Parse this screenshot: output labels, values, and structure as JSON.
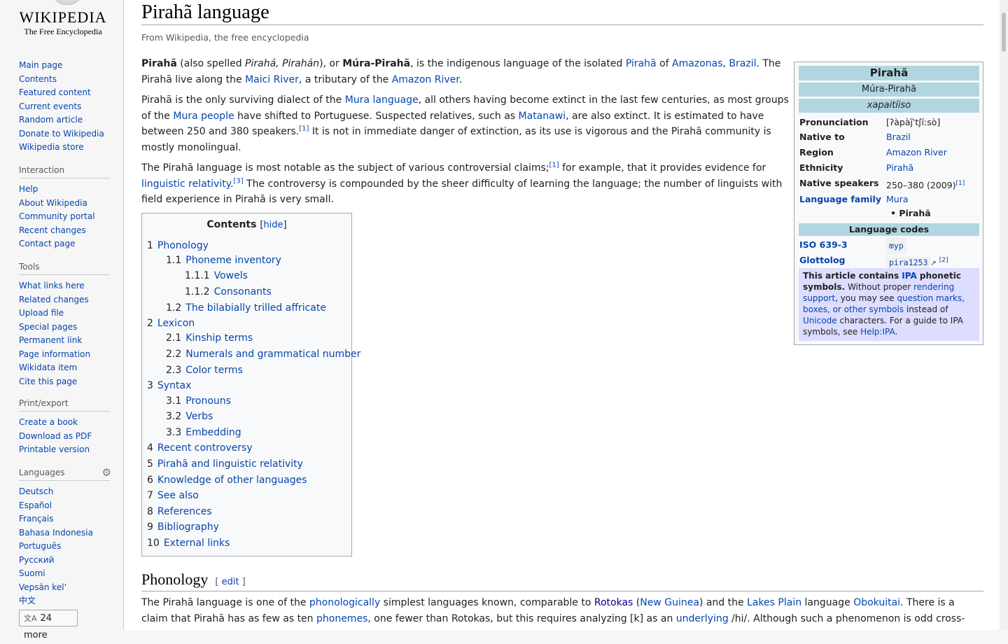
{
  "logo": {
    "wordmark": "WIKIPEDIA",
    "tagline": "The Free Encyclopedia"
  },
  "sidebar": {
    "navigation": [
      "Main page",
      "Contents",
      "Featured content",
      "Current events",
      "Random article",
      "Donate to Wikipedia",
      "Wikipedia store"
    ],
    "interaction": {
      "heading": "Interaction",
      "items": [
        "Help",
        "About Wikipedia",
        "Community portal",
        "Recent changes",
        "Contact page"
      ]
    },
    "tools": {
      "heading": "Tools",
      "items": [
        "What links here",
        "Related changes",
        "Upload file",
        "Special pages",
        "Permanent link",
        "Page information",
        "Wikidata item",
        "Cite this page"
      ]
    },
    "print": {
      "heading": "Print/export",
      "items": [
        "Create a book",
        "Download as PDF",
        "Printable version"
      ]
    },
    "languages": {
      "heading": "Languages",
      "items": [
        "Deutsch",
        "Español",
        "Français",
        "Bahasa Indonesia",
        "Português",
        "Русский",
        "Suomi",
        "Vepsän kel’",
        "中文"
      ],
      "more_icon": "文A",
      "more_label": "24 more",
      "settings_icon": "gear-icon"
    }
  },
  "page": {
    "title": "Pirahã language",
    "tagline": "From Wikipedia, the free encyclopedia"
  },
  "intro": {
    "p1": {
      "t0": "Pirahã",
      "t1": " (also spelled ",
      "t2": "Pirahá, Pirahán",
      "t3": "), or ",
      "t4": "Múra-Pirahã",
      "t5": ", is the indigenous language of the isolated ",
      "l1": "Pirahã",
      "t6": " of ",
      "l2": "Amazonas",
      "t7": ", ",
      "l3": "Brazil",
      "t8": ". The Pirahã live along the ",
      "l4": "Maici River",
      "t9": ", a tributary of the ",
      "l5": "Amazon River",
      "t10": "."
    },
    "p2": {
      "t1": "Pirahã is the only surviving dialect of the ",
      "l1": "Mura language",
      "t2": ", all others having become extinct in the last few centuries, as most groups of the ",
      "l2": "Mura people",
      "t3": " have shifted to Portuguese. Suspected relatives, such as ",
      "l3": "Matanawi",
      "t4": ", are also extinct. It is estimated to have between 250 and 380 speakers.",
      "r1": "[1]",
      "t5": " It is not in immediate danger of extinction, as its use is vigorous and the Pirahã community is mostly monolingual."
    },
    "p3": {
      "t1": "The Pirahã language is most notable as the subject of various controversial claims;",
      "r1": "[1]",
      "t2": " for example, that it provides evidence for ",
      "l1": "linguistic relativity",
      "t3": ".",
      "r2": "[3]",
      "t4": " The controversy is compounded by the sheer difficulty of learning the language; the number of linguists with field experience in Pirahã is very small."
    }
  },
  "infobox": {
    "name": "Pirahã",
    "native_name": "Múra-Pirahã",
    "native_script": "xapaitíiso",
    "rows": [
      {
        "label": "Pronunciation",
        "value": "[ʔàpàj̃ˈtʃíːsò]"
      },
      {
        "label": "Native to",
        "value": "Brazil"
      },
      {
        "label": "Region",
        "value": "Amazon River"
      },
      {
        "label": "Ethnicity",
        "value": "Pirahã"
      },
      {
        "label": "Native speakers",
        "value": "250–380 (2009)",
        "ref": "[1]"
      },
      {
        "label": "Language family",
        "value": "Mura",
        "sub": "Pirahã"
      }
    ],
    "codes_heading": "Language codes",
    "iso_label": "ISO 639-3",
    "iso_value": "myp",
    "glotto_label": "Glottolog",
    "glotto_value": "pira1253",
    "glotto_ref": "[2]",
    "ext_icon": "external-link-icon",
    "note": {
      "b1": "This article contains ",
      "l1": "IPA",
      "b2": " phonetic symbols.",
      "t1": " Without proper ",
      "l2": "rendering support",
      "t2": ", you may see ",
      "l3": "question marks, boxes, or other symbols",
      "t3": " instead of ",
      "l4": "Unicode",
      "t4": " characters. For a guide to IPA symbols, see ",
      "l5": "Help:IPA",
      "t5": "."
    }
  },
  "toc": {
    "title": "Contents",
    "hide_label": "hide",
    "items": [
      {
        "num": "1",
        "label": "Phonology"
      },
      {
        "num": "1.1",
        "label": "Phoneme inventory"
      },
      {
        "num": "1.1.1",
        "label": "Vowels"
      },
      {
        "num": "1.1.2",
        "label": "Consonants"
      },
      {
        "num": "1.2",
        "label": "The bilabially trilled affricate"
      },
      {
        "num": "2",
        "label": "Lexicon"
      },
      {
        "num": "2.1",
        "label": "Kinship terms"
      },
      {
        "num": "2.2",
        "label": "Numerals and grammatical number"
      },
      {
        "num": "2.3",
        "label": "Color terms"
      },
      {
        "num": "3",
        "label": "Syntax"
      },
      {
        "num": "3.1",
        "label": "Pronouns"
      },
      {
        "num": "3.2",
        "label": "Verbs"
      },
      {
        "num": "3.3",
        "label": "Embedding"
      },
      {
        "num": "4",
        "label": "Recent controversy"
      },
      {
        "num": "5",
        "label": "Pirahã and linguistic relativity"
      },
      {
        "num": "6",
        "label": "Knowledge of other languages"
      },
      {
        "num": "7",
        "label": "See also"
      },
      {
        "num": "8",
        "label": "References"
      },
      {
        "num": "9",
        "label": "Bibliography"
      },
      {
        "num": "10",
        "label": "External links"
      }
    ]
  },
  "phonology": {
    "heading": "Phonology",
    "edit_label": "edit",
    "p1": {
      "t1": "The Pirahã language is one of the ",
      "l1": "phonologically",
      "t2": " simplest languages known, comparable to ",
      "l2": "Rotokas",
      "t3": " (",
      "l3": "New Guinea",
      "t4": ") and the ",
      "l4": "Lakes Plain",
      "t5": " language ",
      "l5": "Obokuitai",
      "t6": ". There is a claim that Pirahã has as few as ten ",
      "l6": "phonemes",
      "t7": ", one fewer than Rotokas, but this requires analyzing [k] as an ",
      "l7": "underlying",
      "t8": " /hi/. Although such a phenomenon is odd cross-"
    }
  },
  "colors": {
    "link": "#0645ad",
    "infobox_band": "#b0d6e0",
    "ipa_note": "#ddddff",
    "sidebar_bg": "#f6f6f6"
  }
}
